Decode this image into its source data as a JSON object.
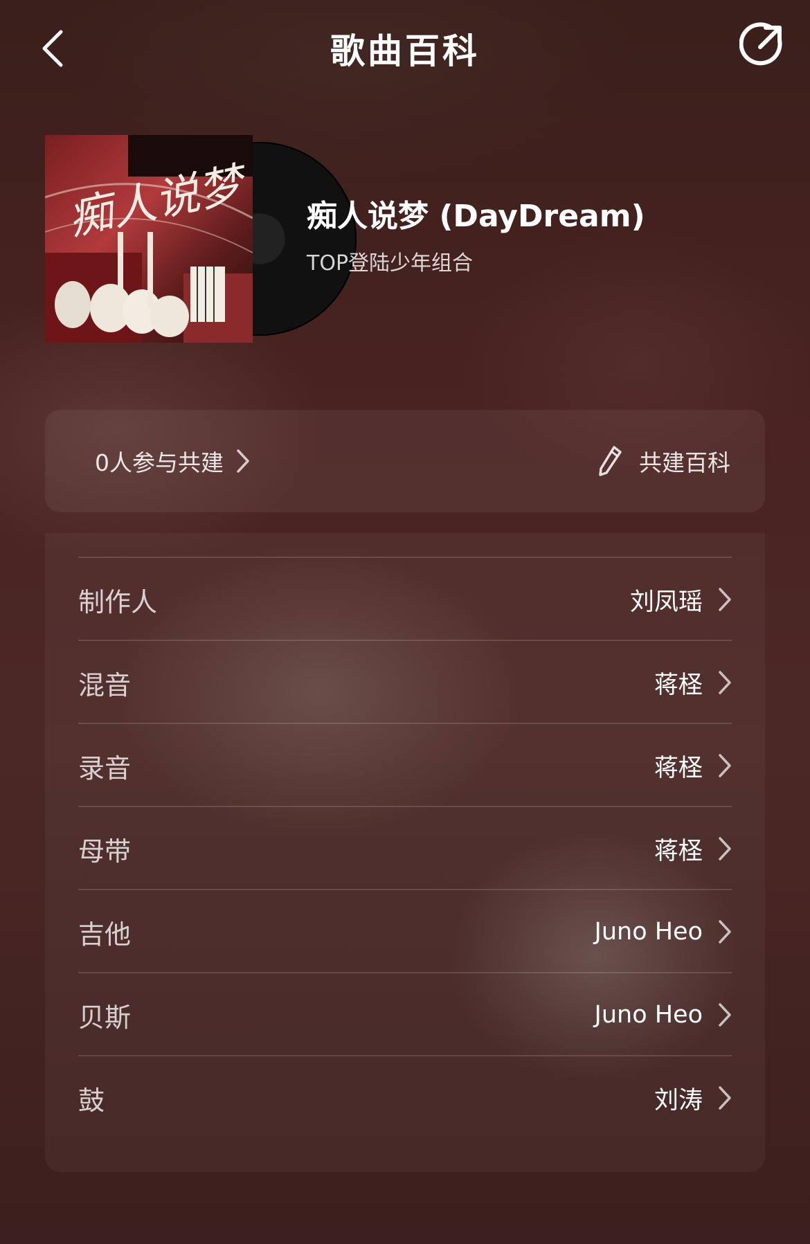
{
  "header": {
    "title": "歌曲百科",
    "back_icon": "chevron-left-icon",
    "share_icon": "share-icon"
  },
  "album": {
    "cover_icon": "album-cover-art",
    "cover_text": "痴人说梦"
  },
  "song": {
    "title": "痴人说梦 (DayDream)",
    "artist": "TOP登陆少年组合"
  },
  "contribution": {
    "participants_label": "0人参与共建",
    "edit_label": "共建百科",
    "edit_icon": "pencil-icon"
  },
  "credits": [
    {
      "role": "制作人",
      "name": "刘凤瑶"
    },
    {
      "role": "混音",
      "name": "蒋柽"
    },
    {
      "role": "录音",
      "name": "蒋柽"
    },
    {
      "role": "母带",
      "name": "蒋柽"
    },
    {
      "role": "吉他",
      "name": "Juno Heo"
    },
    {
      "role": "贝斯",
      "name": "Juno Heo"
    },
    {
      "role": "鼓",
      "name": "刘涛"
    }
  ]
}
